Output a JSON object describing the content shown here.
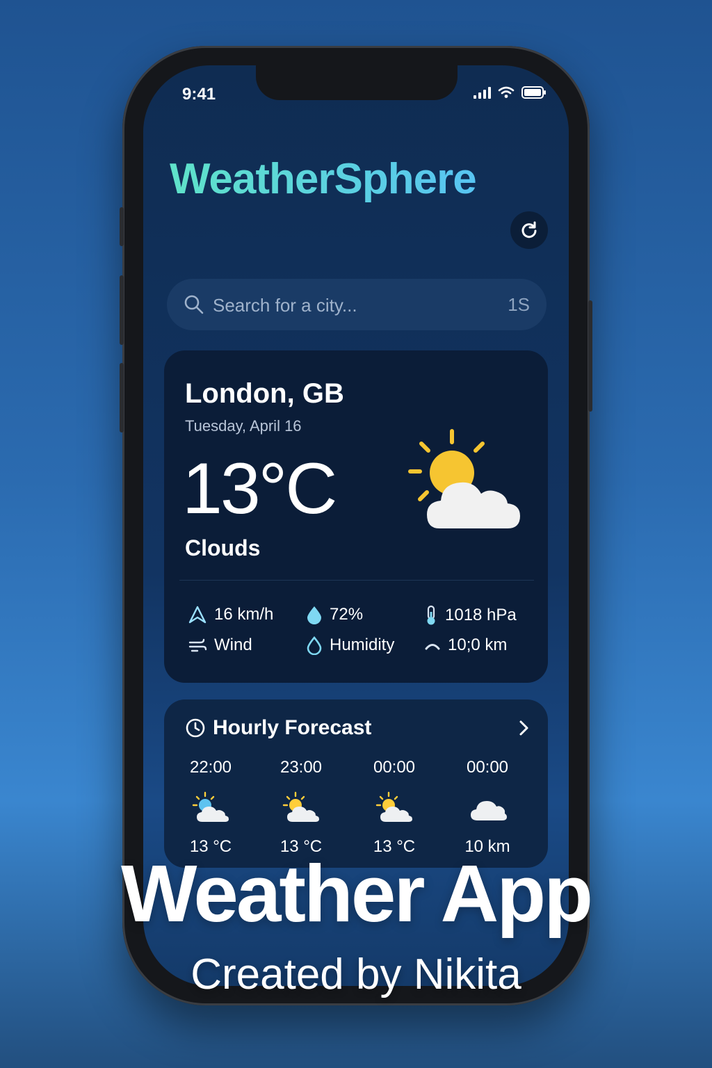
{
  "status_bar": {
    "time": "9:41"
  },
  "header": {
    "app_title": "WeatherSphere"
  },
  "search": {
    "placeholder": "Search for a city...",
    "suffix": "1S"
  },
  "current": {
    "city": "London, GB",
    "date": "Tuesday, April 16",
    "temperature": "13°C",
    "condition": "Clouds",
    "metrics": {
      "wind_speed": "16 km/h",
      "wind_label": "Wind",
      "humidity_value": "72%",
      "humidity_label": "Humidity",
      "pressure": "1018 hPa",
      "visibility": "10;0 km"
    }
  },
  "hourly": {
    "title": "Hourly Forecast",
    "items": [
      {
        "time": "22:00",
        "value": "13 °C",
        "icon": "partly-cloudy-icon"
      },
      {
        "time": "23:00",
        "value": "13 °C",
        "icon": "partly-cloudy-icon"
      },
      {
        "time": "00:00",
        "value": "13 °C",
        "icon": "partly-cloudy-icon"
      },
      {
        "time": "00:00",
        "value": "10 km",
        "icon": "cloud-icon"
      }
    ]
  },
  "overlay": {
    "title": "Weather App",
    "subtitle": "Created by Nikita"
  },
  "colors": {
    "accent_teal": "#5fe2c9",
    "accent_blue": "#58c4f2",
    "sun": "#f6c531",
    "card": "#0b1d38"
  }
}
